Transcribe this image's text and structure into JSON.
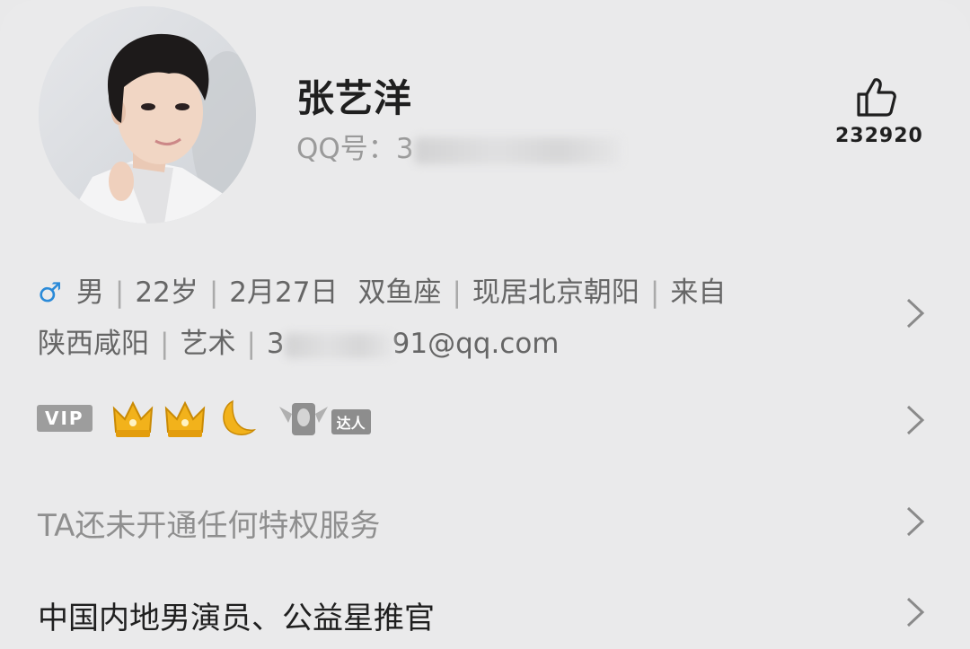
{
  "profile": {
    "name": "张艺洋",
    "qq_label": "QQ号：",
    "qq_visible": "3"
  },
  "likes": {
    "count": "232920",
    "icon": "thumbs-up-icon"
  },
  "info": {
    "gender_symbol": "♂",
    "gender": "男",
    "age": "22岁",
    "birthday": "2月27日",
    "zodiac": "双鱼座",
    "residence": "现居北京朝阳",
    "from_prefix": "来自",
    "hometown": "陕西咸阳",
    "profession": "艺术",
    "email_prefix": "3",
    "email_suffix": "91@qq.com"
  },
  "badges": {
    "vip_label": "VIP",
    "crown_count": 2,
    "moon_count": 1,
    "daren_label": "达人"
  },
  "privilege_text": "TA还未开通任何特权服务",
  "title_text": "中国内地男演员、公益星推官",
  "colors": {
    "background": "#eaeaeb",
    "gender_blue": "#2a8ad8",
    "crown_gold": "#f2b21b"
  }
}
